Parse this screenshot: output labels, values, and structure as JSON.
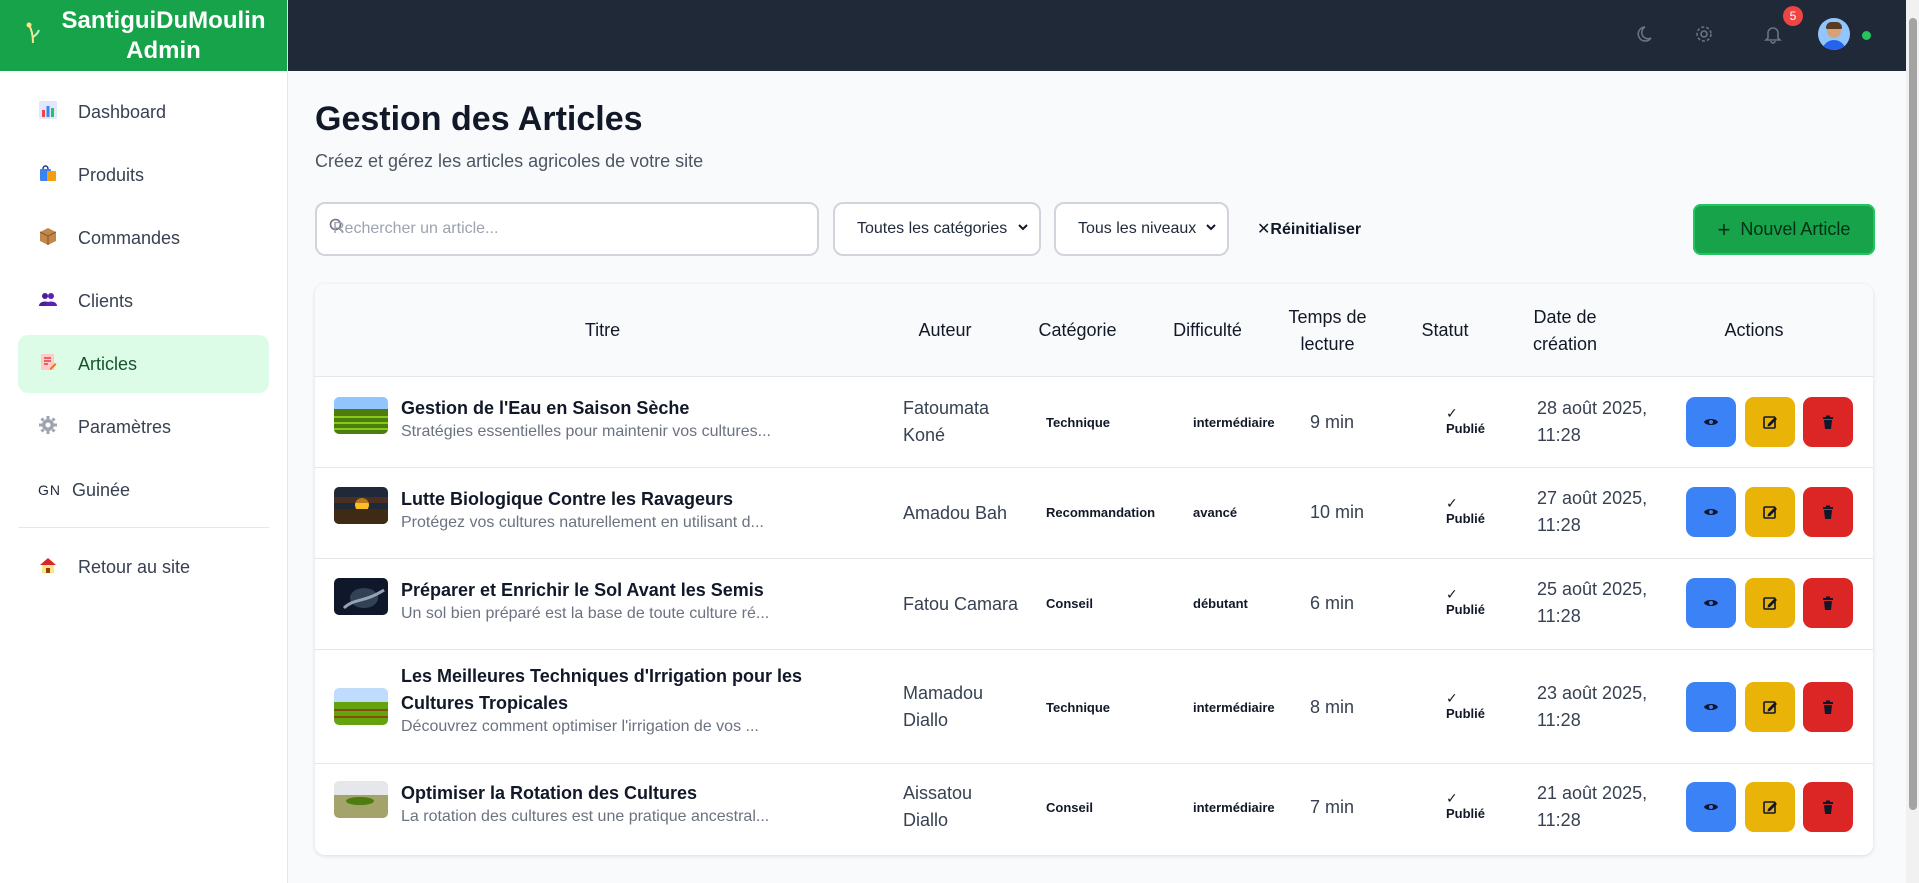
{
  "brand": {
    "name_line1": "SantiguiDuMoulin",
    "name_line2": "Admin"
  },
  "sidebar": {
    "items": [
      {
        "label": "Dashboard",
        "icon": "chart-icon"
      },
      {
        "label": "Produits",
        "icon": "shopping-bag-icon"
      },
      {
        "label": "Commandes",
        "icon": "package-icon"
      },
      {
        "label": "Clients",
        "icon": "users-icon"
      },
      {
        "label": "Articles",
        "icon": "article-icon",
        "active": true
      },
      {
        "label": "Paramètres",
        "icon": "gear-icon"
      },
      {
        "label": "Guinée",
        "icon_text": "GN"
      },
      {
        "label": "Retour au site",
        "icon": "house-icon"
      }
    ]
  },
  "topbar": {
    "notification_count": "5"
  },
  "header": {
    "title": "Gestion des Articles",
    "subtitle": "Créez et gérez les articles agricoles de votre site"
  },
  "filters": {
    "search_placeholder": "Rechercher un article...",
    "category_select": "Toutes les catégories",
    "level_select": "Tous les niveaux",
    "reset_label": "Réinitialiser",
    "new_article_label": "Nouvel Article"
  },
  "table": {
    "headers": {
      "title": "Titre",
      "author": "Auteur",
      "category": "Catégorie",
      "difficulty": "Difficulté",
      "reading_time_1": "Temps de",
      "reading_time_2": "lecture",
      "status": "Statut",
      "created_1": "Date de",
      "created_2": "création",
      "actions": "Actions"
    },
    "rows": [
      {
        "title": "Gestion de l'Eau en Saison Sèche",
        "excerpt": "Stratégies essentielles pour maintenir vos cultures...",
        "author_1": "Fatoumata",
        "author_2": "Koné",
        "category": "Technique",
        "difficulty": "intermédiaire",
        "time": "9 min",
        "status": "Publié",
        "date_1": "28 août 2025,",
        "date_2": "11:28"
      },
      {
        "title": "Lutte Biologique Contre les Ravageurs",
        "excerpt": "Protégez vos cultures naturellement en utilisant d...",
        "author_1": "Amadou Bah",
        "author_2": "",
        "category": "Recommandation",
        "difficulty": "avancé",
        "time": "10 min",
        "status": "Publié",
        "date_1": "27 août 2025,",
        "date_2": "11:28"
      },
      {
        "title": "Préparer et Enrichir le Sol Avant les Semis",
        "excerpt": "Un sol bien préparé est la base de toute culture ré...",
        "author_1": "Fatou Camara",
        "author_2": "",
        "category": "Conseil",
        "difficulty": "débutant",
        "time": "6 min",
        "status": "Publié",
        "date_1": "25 août 2025,",
        "date_2": "11:28"
      },
      {
        "title_1": "Les Meilleures Techniques d'Irrigation pour les",
        "title_2": "Cultures Tropicales",
        "excerpt": "Découvrez comment optimiser l'irrigation de vos ...",
        "author_1": "Mamadou",
        "author_2": "Diallo",
        "category": "Technique",
        "difficulty": "intermédiaire",
        "time": "8 min",
        "status": "Publié",
        "date_1": "23 août 2025,",
        "date_2": "11:28"
      },
      {
        "title": "Optimiser la Rotation des Cultures",
        "excerpt": "La rotation des cultures est une pratique ancestral...",
        "author_1": "Aissatou",
        "author_2": "Diallo",
        "category": "Conseil",
        "difficulty": "intermédiaire",
        "time": "7 min",
        "status": "Publié",
        "date_1": "21 août 2025,",
        "date_2": "11:28"
      }
    ]
  },
  "colors": {
    "brand_green": "#16a34a",
    "topbar": "#1f2937",
    "view": "#3b82f6",
    "edit": "#eab308",
    "delete": "#dc2626"
  }
}
